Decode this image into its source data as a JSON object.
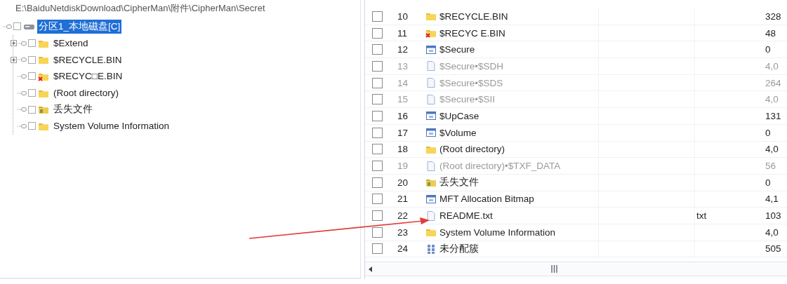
{
  "path": "E:\\BaiduNetdiskDownload\\CipherMan\\附件\\CipherMan\\Secret",
  "tree": {
    "label": "分区1_本地磁盘[C]",
    "kind": "drive",
    "selected": true,
    "checked": false,
    "children": [
      {
        "label": "$Extend",
        "kind": "folder",
        "expandable": true,
        "checked": false,
        "selected": false
      },
      {
        "label": "$RECYCLE.BIN",
        "kind": "folder",
        "expandable": true,
        "checked": false,
        "selected": false
      },
      {
        "label": "$RECYC□E.BIN",
        "kind": "deleted",
        "expandable": false,
        "checked": false,
        "selected": false
      },
      {
        "label": "(Root directory)",
        "kind": "folder",
        "expandable": false,
        "checked": false,
        "selected": false
      },
      {
        "label": "丢失文件",
        "kind": "lost",
        "expandable": false,
        "checked": false,
        "selected": false
      },
      {
        "label": "System Volume Information",
        "kind": "folder",
        "expandable": false,
        "checked": false,
        "selected": false
      }
    ]
  },
  "files": [
    {
      "number": "10",
      "name": "$RECYCLE.BIN",
      "kind": "folder",
      "dimmed": false,
      "checked": false,
      "size": "328"
    },
    {
      "number": "11",
      "name": "$RECYC E.BIN",
      "kind": "deleted",
      "dimmed": false,
      "checked": false,
      "size": "48"
    },
    {
      "number": "12",
      "name": "$Secure",
      "kind": "system",
      "dimmed": false,
      "checked": false,
      "size": "0"
    },
    {
      "number": "13",
      "name": "$Secure•$SDH",
      "kind": "file",
      "dimmed": true,
      "checked": false,
      "size": "4,0"
    },
    {
      "number": "14",
      "name": "$Secure•$SDS",
      "kind": "file",
      "dimmed": true,
      "checked": false,
      "size": "264"
    },
    {
      "number": "15",
      "name": "$Secure•$SII",
      "kind": "file",
      "dimmed": true,
      "checked": false,
      "size": "4,0"
    },
    {
      "number": "16",
      "name": "$UpCase",
      "kind": "system",
      "dimmed": false,
      "checked": false,
      "size": "131"
    },
    {
      "number": "17",
      "name": "$Volume",
      "kind": "system",
      "dimmed": false,
      "checked": false,
      "size": "0"
    },
    {
      "number": "18",
      "name": "(Root directory)",
      "kind": "folder",
      "dimmed": false,
      "checked": false,
      "size": "4,0"
    },
    {
      "number": "19",
      "name": "(Root directory)•$TXF_DATA",
      "kind": "file",
      "dimmed": true,
      "checked": false,
      "size": "56"
    },
    {
      "number": "20",
      "name": "丢失文件",
      "kind": "lost",
      "dimmed": false,
      "checked": false,
      "size": "0"
    },
    {
      "number": "21",
      "name": "MFT Allocation Bitmap",
      "kind": "system",
      "dimmed": false,
      "checked": false,
      "size": "4,1"
    },
    {
      "number": "22",
      "name": "README.txt",
      "kind": "file",
      "dimmed": false,
      "checked": false,
      "ext": "txt",
      "size": "103"
    },
    {
      "number": "23",
      "name": "System Volume Information",
      "kind": "folder",
      "dimmed": false,
      "checked": false,
      "size": "4,0"
    },
    {
      "number": "24",
      "name": "未分配簇",
      "kind": "unallocated",
      "dimmed": false,
      "checked": false,
      "size": "505"
    }
  ]
}
